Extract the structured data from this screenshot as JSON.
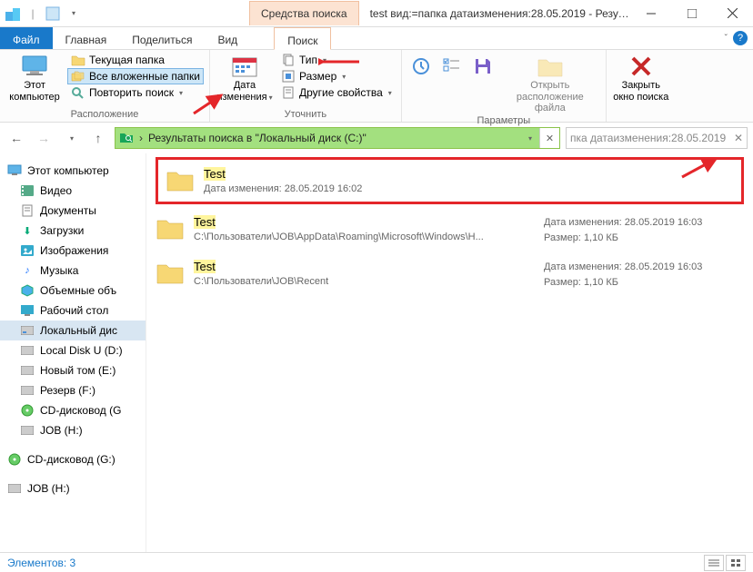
{
  "titlebar": {
    "context_header": "Средства поиска",
    "title": "test вид:=папка датаизменения:28.05.2019 - Результа..."
  },
  "tabs": {
    "file": "Файл",
    "home": "Главная",
    "share": "Поделиться",
    "view": "Вид",
    "search": "Поиск"
  },
  "ribbon": {
    "group1": {
      "this_pc": "Этот компьютер",
      "current_folder": "Текущая папка",
      "all_subfolders": "Все вложенные папки",
      "repeat_search": "Повторить поиск",
      "title": "Расположение"
    },
    "group2": {
      "date_modified": "Дата изменения",
      "type": "Тип",
      "size": "Размер",
      "other_props": "Другие свойства",
      "title": "Уточнить"
    },
    "group3": {
      "open_location": "Открыть расположение файла",
      "title": "Параметры"
    },
    "group4": {
      "close_search": "Закрыть окно поиска"
    }
  },
  "address": {
    "text": "Результаты поиска в \"Локальный диск (C:)\""
  },
  "search": {
    "text": "пка датаизменения:28.05.2019"
  },
  "nav": {
    "this_pc": "Этот компьютер",
    "video": "Видео",
    "documents": "Документы",
    "downloads": "Загрузки",
    "pictures": "Изображения",
    "music": "Музыка",
    "objects3d": "Объемные объ",
    "desktop": "Рабочий стол",
    "local_c": "Локальный дис",
    "local_u": "Local Disk U (D:)",
    "new_vol": "Новый том (E:)",
    "reserve": "Резерв (F:)",
    "cd_g": "CD-дисковод (G",
    "job_h": "JOB (H:)",
    "cd_g2": "CD-дисковод (G:)",
    "job_h2": "JOB (H:)"
  },
  "results": [
    {
      "name": "Test",
      "sub_label": "Дата изменения:",
      "sub_value": "28.05.2019 16:02",
      "highlighted": true
    },
    {
      "name": "Test",
      "path": "C:\\Пользователи\\JOB\\AppData\\Roaming\\Microsoft\\Windows\\H...",
      "date_label": "Дата изменения:",
      "date_value": "28.05.2019 16:03",
      "size_label": "Размер:",
      "size_value": "1,10 КБ"
    },
    {
      "name": "Test",
      "path": "C:\\Пользователи\\JOB\\Recent",
      "date_label": "Дата изменения:",
      "date_value": "28.05.2019 16:03",
      "size_label": "Размер:",
      "size_value": "1,10 КБ"
    }
  ],
  "status": {
    "count_label": "Элементов: 3"
  }
}
